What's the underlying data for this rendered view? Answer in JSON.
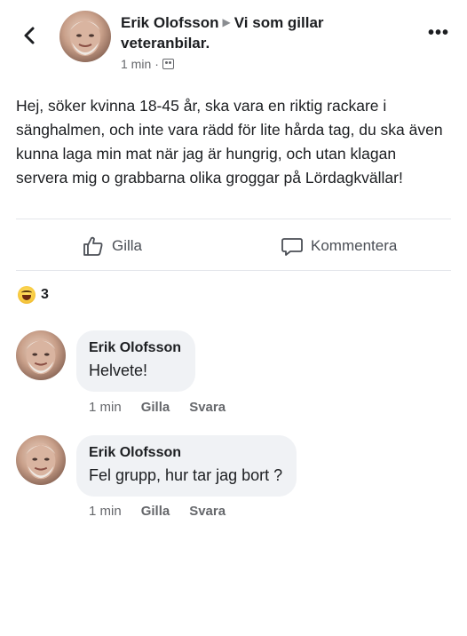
{
  "post": {
    "author": "Erik Olofsson",
    "group": "Vi som gillar veteranbilar.",
    "time": "1 min",
    "separator": "·",
    "text": "Hej, söker kvinna 18-45 år, ska vara en riktig rackare i sänghalmen, och inte vara rädd för lite hårda tag, du ska även kunna laga min mat när jag är hungrig, och utan klagan servera mig o grabbarna olika groggar på Lördagkvällar!"
  },
  "actions": {
    "like_label": "Gilla",
    "comment_label": "Kommentera"
  },
  "reactions": {
    "icon": "haha-emoji",
    "count": "3"
  },
  "comments": [
    {
      "author": "Erik Olofsson",
      "text": "Helvete!",
      "time": "1 min",
      "like_label": "Gilla",
      "reply_label": "Svara"
    },
    {
      "author": "Erik Olofsson",
      "text": "Fel grupp, hur tar jag bort ?",
      "time": "1 min",
      "like_label": "Gilla",
      "reply_label": "Svara"
    }
  ],
  "colors": {
    "text": "#1c1e21",
    "secondary": "#65676b",
    "bubble": "#f0f2f5",
    "divider": "#e4e6eb"
  }
}
